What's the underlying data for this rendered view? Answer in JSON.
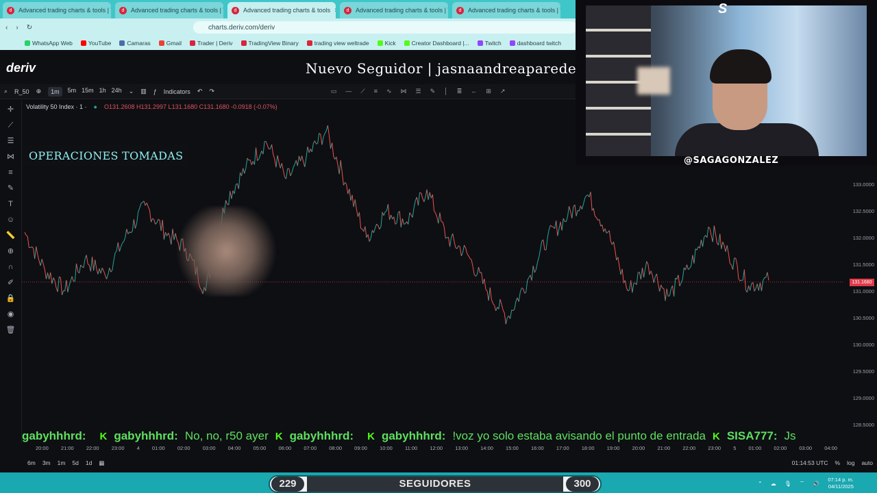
{
  "browser": {
    "tabs": [
      {
        "title": "Advanced trading charts & tools | Tr",
        "active": false
      },
      {
        "title": "Advanced trading charts & tools | Tr",
        "active": false
      },
      {
        "title": "Advanced trading charts & tools",
        "active": true
      },
      {
        "title": "Advanced trading charts & tools | Tr",
        "active": false
      },
      {
        "title": "Advanced trading charts & tools | Tr",
        "active": false
      }
    ],
    "url": "charts.deriv.com/deriv",
    "bookmarks": [
      "WhatsApp Web",
      "YouTube",
      "Camaras",
      "Gmail",
      "Trader | Deriv",
      "TradingView Binary",
      "trading view weltrade",
      "Kick",
      "Creator Dashboard |...",
      "Twitch",
      "dashboard twitch"
    ]
  },
  "app": {
    "logo": "deriv",
    "overlay_follower": "Nuevo Seguidor | jasnaandreaparede"
  },
  "toolbar": {
    "symbol": "R_50",
    "intervals": [
      "1m",
      "5m",
      "15m",
      "1h",
      "24h"
    ],
    "selected_interval": "1m",
    "indicators_label": "Indicators"
  },
  "legend": {
    "name": "Volatility 50 Index · 1 ·",
    "ohlc": "O131.2608 H131.2997 L131.1680 C131.1680 -0.0918 (-0.07%)"
  },
  "overlay_title": "OPERACIONES TOMADAS",
  "chart_data": {
    "type": "line",
    "ylim": [
      128.5,
      133.0
    ],
    "yticks": [
      "133.0000",
      "132.5000",
      "132.0000",
      "131.5000",
      "131.0000",
      "130.5000",
      "130.0000",
      "129.5000",
      "129.0000",
      "128.5000"
    ],
    "current_price": "131.1680",
    "xticks": [
      "20:00",
      "21:00",
      "22:00",
      "23:00",
      "4",
      "01:00",
      "02:00",
      "03:00",
      "04:00",
      "05:00",
      "06:00",
      "07:00",
      "08:00",
      "09:00",
      "10:00",
      "11:00",
      "12:00",
      "13:00",
      "14:00",
      "15:00",
      "16:00",
      "17:00",
      "18:00",
      "19:00",
      "20:00",
      "21:00",
      "22:00",
      "23:00",
      "5",
      "01:00",
      "02:00",
      "03:00",
      "04:00"
    ],
    "series": [
      {
        "values": [
          132.1,
          131.4,
          131.0,
          131.6,
          131.3,
          132.0,
          132.6,
          132.1,
          131.8,
          131.0,
          132.7,
          133.3,
          133.8,
          133.1,
          133.5,
          134.0,
          133.0,
          132.0,
          132.5,
          132.3,
          132.9,
          132.0,
          131.7,
          131.0,
          130.5,
          131.2,
          132.0,
          132.4,
          132.8,
          132.1,
          131.0,
          131.5,
          130.9,
          131.4,
          132.2,
          131.7,
          131.1,
          131.2
        ]
      }
    ],
    "colors": {
      "up": "#26a69a",
      "down": "#ef5350"
    }
  },
  "time_display": "01:14:53 UTC",
  "periods": [
    "6m",
    "3m",
    "1m",
    "5d",
    "1d"
  ],
  "scale": {
    "percent": "%",
    "log": "log",
    "auto": "auto"
  },
  "webcam": {
    "handle": "@SAGAGONZALEZ"
  },
  "chat": [
    {
      "user": "gabyhhhrd:",
      "message": ""
    },
    {
      "user": "gabyhhhrd:",
      "message": "No, no, r50 ayer"
    },
    {
      "user": "gabyhhhrd:",
      "message": ""
    },
    {
      "user": "gabyhhhrd:",
      "message": "!voz yo solo estaba avisando el punto de entrada"
    },
    {
      "user": "SISA777:",
      "message": "Js"
    }
  ],
  "follower_goal": {
    "current": "229",
    "label": "SEGUIDORES",
    "goal": "300"
  },
  "clock": {
    "time": "07:14 p. m.",
    "date": "04/11/2025"
  }
}
